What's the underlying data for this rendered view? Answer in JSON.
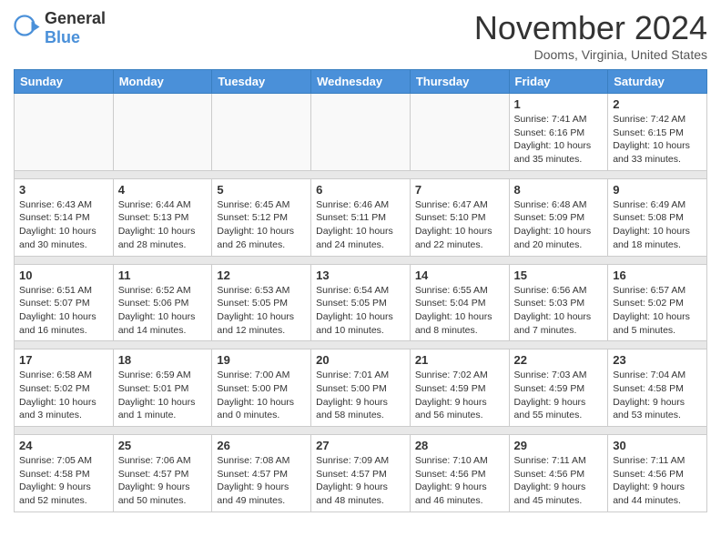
{
  "header": {
    "logo_general": "General",
    "logo_blue": "Blue",
    "title": "November 2024",
    "location": "Dooms, Virginia, United States"
  },
  "weekdays": [
    "Sunday",
    "Monday",
    "Tuesday",
    "Wednesday",
    "Thursday",
    "Friday",
    "Saturday"
  ],
  "weeks": [
    [
      {
        "day": "",
        "info": ""
      },
      {
        "day": "",
        "info": ""
      },
      {
        "day": "",
        "info": ""
      },
      {
        "day": "",
        "info": ""
      },
      {
        "day": "",
        "info": ""
      },
      {
        "day": "1",
        "info": "Sunrise: 7:41 AM\nSunset: 6:16 PM\nDaylight: 10 hours and 35 minutes."
      },
      {
        "day": "2",
        "info": "Sunrise: 7:42 AM\nSunset: 6:15 PM\nDaylight: 10 hours and 33 minutes."
      }
    ],
    [
      {
        "day": "3",
        "info": "Sunrise: 6:43 AM\nSunset: 5:14 PM\nDaylight: 10 hours and 30 minutes."
      },
      {
        "day": "4",
        "info": "Sunrise: 6:44 AM\nSunset: 5:13 PM\nDaylight: 10 hours and 28 minutes."
      },
      {
        "day": "5",
        "info": "Sunrise: 6:45 AM\nSunset: 5:12 PM\nDaylight: 10 hours and 26 minutes."
      },
      {
        "day": "6",
        "info": "Sunrise: 6:46 AM\nSunset: 5:11 PM\nDaylight: 10 hours and 24 minutes."
      },
      {
        "day": "7",
        "info": "Sunrise: 6:47 AM\nSunset: 5:10 PM\nDaylight: 10 hours and 22 minutes."
      },
      {
        "day": "8",
        "info": "Sunrise: 6:48 AM\nSunset: 5:09 PM\nDaylight: 10 hours and 20 minutes."
      },
      {
        "day": "9",
        "info": "Sunrise: 6:49 AM\nSunset: 5:08 PM\nDaylight: 10 hours and 18 minutes."
      }
    ],
    [
      {
        "day": "10",
        "info": "Sunrise: 6:51 AM\nSunset: 5:07 PM\nDaylight: 10 hours and 16 minutes."
      },
      {
        "day": "11",
        "info": "Sunrise: 6:52 AM\nSunset: 5:06 PM\nDaylight: 10 hours and 14 minutes."
      },
      {
        "day": "12",
        "info": "Sunrise: 6:53 AM\nSunset: 5:05 PM\nDaylight: 10 hours and 12 minutes."
      },
      {
        "day": "13",
        "info": "Sunrise: 6:54 AM\nSunset: 5:05 PM\nDaylight: 10 hours and 10 minutes."
      },
      {
        "day": "14",
        "info": "Sunrise: 6:55 AM\nSunset: 5:04 PM\nDaylight: 10 hours and 8 minutes."
      },
      {
        "day": "15",
        "info": "Sunrise: 6:56 AM\nSunset: 5:03 PM\nDaylight: 10 hours and 7 minutes."
      },
      {
        "day": "16",
        "info": "Sunrise: 6:57 AM\nSunset: 5:02 PM\nDaylight: 10 hours and 5 minutes."
      }
    ],
    [
      {
        "day": "17",
        "info": "Sunrise: 6:58 AM\nSunset: 5:02 PM\nDaylight: 10 hours and 3 minutes."
      },
      {
        "day": "18",
        "info": "Sunrise: 6:59 AM\nSunset: 5:01 PM\nDaylight: 10 hours and 1 minute."
      },
      {
        "day": "19",
        "info": "Sunrise: 7:00 AM\nSunset: 5:00 PM\nDaylight: 10 hours and 0 minutes."
      },
      {
        "day": "20",
        "info": "Sunrise: 7:01 AM\nSunset: 5:00 PM\nDaylight: 9 hours and 58 minutes."
      },
      {
        "day": "21",
        "info": "Sunrise: 7:02 AM\nSunset: 4:59 PM\nDaylight: 9 hours and 56 minutes."
      },
      {
        "day": "22",
        "info": "Sunrise: 7:03 AM\nSunset: 4:59 PM\nDaylight: 9 hours and 55 minutes."
      },
      {
        "day": "23",
        "info": "Sunrise: 7:04 AM\nSunset: 4:58 PM\nDaylight: 9 hours and 53 minutes."
      }
    ],
    [
      {
        "day": "24",
        "info": "Sunrise: 7:05 AM\nSunset: 4:58 PM\nDaylight: 9 hours and 52 minutes."
      },
      {
        "day": "25",
        "info": "Sunrise: 7:06 AM\nSunset: 4:57 PM\nDaylight: 9 hours and 50 minutes."
      },
      {
        "day": "26",
        "info": "Sunrise: 7:08 AM\nSunset: 4:57 PM\nDaylight: 9 hours and 49 minutes."
      },
      {
        "day": "27",
        "info": "Sunrise: 7:09 AM\nSunset: 4:57 PM\nDaylight: 9 hours and 48 minutes."
      },
      {
        "day": "28",
        "info": "Sunrise: 7:10 AM\nSunset: 4:56 PM\nDaylight: 9 hours and 46 minutes."
      },
      {
        "day": "29",
        "info": "Sunrise: 7:11 AM\nSunset: 4:56 PM\nDaylight: 9 hours and 45 minutes."
      },
      {
        "day": "30",
        "info": "Sunrise: 7:11 AM\nSunset: 4:56 PM\nDaylight: 9 hours and 44 minutes."
      }
    ]
  ]
}
